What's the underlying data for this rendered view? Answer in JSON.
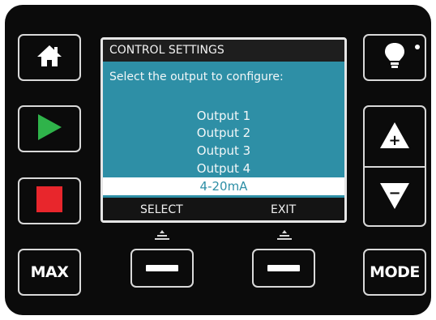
{
  "screen": {
    "title": "CONTROL SETTINGS",
    "prompt": "Select the output to configure:",
    "options": [
      "Output 1",
      "Output 2",
      "Output 3",
      "Output 4",
      "4-20mA"
    ],
    "selected_index": 4,
    "softkeys": {
      "left": "SELECT",
      "right": "EXIT"
    }
  },
  "buttons": {
    "max_label": "MAX",
    "mode_label": "MODE",
    "up_label": "+",
    "down_label": "−"
  },
  "icons": {
    "home": "home-icon",
    "play": "play-icon",
    "stop": "stop-icon",
    "light": "lightbulb-icon",
    "up": "up-arrow-icon",
    "down": "down-arrow-icon"
  },
  "colors": {
    "screen_body": "#2e8fa6",
    "play": "#2fb34a",
    "stop": "#e8262c",
    "panel": "#0b0b0b"
  }
}
